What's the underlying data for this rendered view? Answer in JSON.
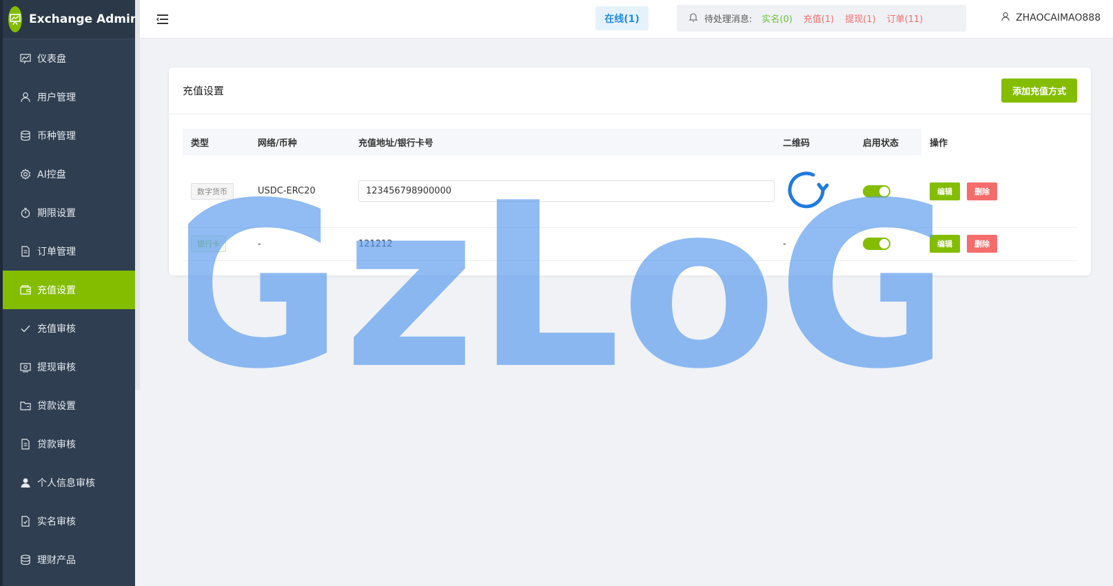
{
  "app": {
    "title": "Exchange Admin"
  },
  "sidebar": {
    "items": [
      {
        "label": "仪表盘",
        "icon": "dashboard-icon"
      },
      {
        "label": "用户管理",
        "icon": "user-icon"
      },
      {
        "label": "币种管理",
        "icon": "database-icon"
      },
      {
        "label": "AI控盘",
        "icon": "gear-icon"
      },
      {
        "label": "期限设置",
        "icon": "stopwatch-icon"
      },
      {
        "label": "订单管理",
        "icon": "document-icon"
      },
      {
        "label": "充值设置",
        "icon": "wallet-icon",
        "active": true
      },
      {
        "label": "充值审核",
        "icon": "check-icon"
      },
      {
        "label": "提现审核",
        "icon": "money-icon"
      },
      {
        "label": "贷款设置",
        "icon": "folder-icon"
      },
      {
        "label": "贷款审核",
        "icon": "document-icon"
      },
      {
        "label": "个人信息审核",
        "icon": "person-icon"
      },
      {
        "label": "实名审核",
        "icon": "file-check-icon"
      },
      {
        "label": "理财产品",
        "icon": "database-icon"
      }
    ]
  },
  "header": {
    "online": "在线(1)",
    "pending_label": "待处理消息:",
    "pending": [
      {
        "label": "实名(0)",
        "color": "#67c23a"
      },
      {
        "label": "充值(1)",
        "color": "#f56c6c"
      },
      {
        "label": "提现(1)",
        "color": "#f56c6c"
      },
      {
        "label": "订单(11)",
        "color": "#f56c6c"
      }
    ],
    "username": "ZHAOCAIMAO888"
  },
  "card": {
    "title": "充值设置",
    "add_button": "添加充值方式"
  },
  "table": {
    "columns": [
      "类型",
      "网络/币种",
      "充值地址/银行卡号",
      "二维码",
      "启用状态",
      "操作"
    ],
    "rows": [
      {
        "type": "数字货币",
        "network": "USDC-ERC20",
        "address": "123456798900000",
        "qrcode": "loading",
        "enabled": true,
        "edit": "编辑",
        "delete": "删除"
      },
      {
        "type": "银行卡",
        "network": "-",
        "address": "121212",
        "qrcode": "-",
        "enabled": true,
        "edit": "编辑",
        "delete": "删除"
      }
    ]
  },
  "watermark": {
    "text": "GzLoG",
    "color": "#5b9bee"
  },
  "colors": {
    "accent": "#84bd00",
    "sidebar": "#2f3e50",
    "danger": "#f56c6c"
  }
}
